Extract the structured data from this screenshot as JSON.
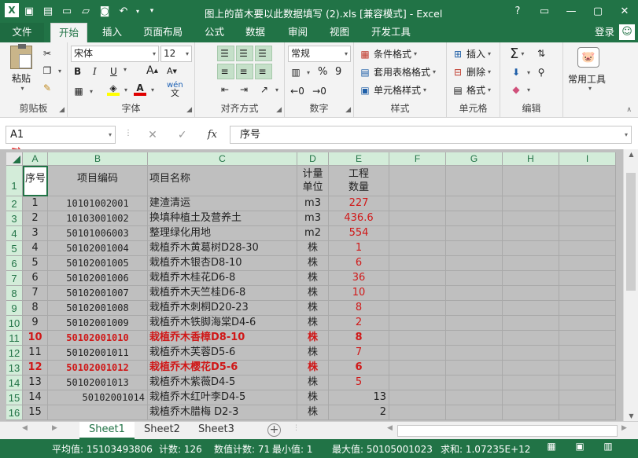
{
  "window": {
    "title": "图上的苗木要以此数据填写 (2).xls  [兼容模式] - Excel",
    "controls": [
      "?",
      "▭",
      "—",
      "▢",
      "✕"
    ]
  },
  "ribbon_tabs": {
    "file": "文件",
    "home": "开始",
    "insert": "插入",
    "layout": "页面布局",
    "formulas": "公式",
    "data": "数据",
    "review": "审阅",
    "view": "视图",
    "developer": "开发工具",
    "login": "登录"
  },
  "ribbon": {
    "clipboard": {
      "paste": "粘贴",
      "label": "剪贴板"
    },
    "font": {
      "name": "宋体",
      "size": "12",
      "bold": "B",
      "italic": "I",
      "underline": "U",
      "grow": "A",
      "shrink": "A",
      "wen": "wén",
      "label": "字体"
    },
    "alignment": {
      "label": "对齐方式"
    },
    "number": {
      "format": "常规",
      "percent": "%",
      "comma": "9",
      "label": "数字"
    },
    "styles": {
      "conditional": "条件格式",
      "table": "套用表格格式",
      "cell": "单元格样式",
      "label": "样式"
    },
    "cells": {
      "insert": "插入",
      "delete": "删除",
      "format": "格式",
      "label": "单元格"
    },
    "editing": {
      "label": "编辑"
    },
    "tools": {
      "label": "常用工具"
    }
  },
  "formula_bar": {
    "name_box": "A1",
    "cancel": "✕",
    "enter": "✓",
    "fx": "fx",
    "content": "序号"
  },
  "grid": {
    "columns": [
      "A",
      "B",
      "C",
      "D",
      "E",
      "F",
      "G",
      "H",
      "I"
    ],
    "rows": [
      {
        "n": "1",
        "a": "序号",
        "b": "项目编码",
        "c": "项目名称",
        "d1": "计量",
        "d2": "单位",
        "e1": "工程",
        "e2": "数量"
      },
      {
        "n": "2",
        "a": "1",
        "b": "10101002001",
        "c": "建渣清运",
        "d": "m3",
        "e": "227"
      },
      {
        "n": "3",
        "a": "2",
        "b": "10103001002",
        "c": "换填种植土及营养土",
        "d": "m3",
        "e": "436.6"
      },
      {
        "n": "4",
        "a": "3",
        "b": "50101006003",
        "c": "整理绿化用地",
        "d": "m2",
        "e": "554"
      },
      {
        "n": "5",
        "a": "4",
        "b": "50102001004",
        "c": "栽植乔木黄葛树D28-30",
        "d": "株",
        "e": "1"
      },
      {
        "n": "6",
        "a": "5",
        "b": "50102001005",
        "c": "栽植乔木银杏D8-10",
        "d": "株",
        "e": "6"
      },
      {
        "n": "7",
        "a": "6",
        "b": "50102001006",
        "c": "栽植乔木桂花D6-8",
        "d": "株",
        "e": "36"
      },
      {
        "n": "8",
        "a": "7",
        "b": "50102001007",
        "c": "栽植乔木天竺桂D6-8",
        "d": "株",
        "e": "10"
      },
      {
        "n": "9",
        "a": "8",
        "b": "50102001008",
        "c": "栽植乔木刺桐D20-23",
        "d": "株",
        "e": "8"
      },
      {
        "n": "10",
        "a": "9",
        "b": "50102001009",
        "c": "栽植乔木铁脚海棠D4-6",
        "d": "株",
        "e": "2"
      },
      {
        "n": "11",
        "a": "10",
        "b": "50102001010",
        "c": "栽植乔木香樟D8-10",
        "d": "株",
        "e": "8"
      },
      {
        "n": "12",
        "a": "11",
        "b": "50102001011",
        "c": "栽植乔木芙蓉D5-6",
        "d": "株",
        "e": "7"
      },
      {
        "n": "13",
        "a": "12",
        "b": "50102001012",
        "c": "栽植乔木樱花D5-6",
        "d": "株",
        "e": "6"
      },
      {
        "n": "14",
        "a": "13",
        "b": "50102001013",
        "c": "栽植乔木紫薇D4-5",
        "d": "株",
        "e": "5"
      },
      {
        "n": "15",
        "a": "14",
        "b": "50102001014",
        "c": "栽植乔木红叶李D4-5",
        "d": "株",
        "e": "13"
      },
      {
        "n": "16",
        "a": "15",
        "b": "",
        "c": "栽植乔木腊梅  D2-3",
        "d": "株",
        "e": "2"
      }
    ]
  },
  "sheets": [
    "Sheet1",
    "Sheet2",
    "Sheet3"
  ],
  "status": {
    "average": "平均值: 15103493806",
    "count": "计数: 126",
    "numcount": "数值计数: 71",
    "min": "最小值: 1",
    "max": "最大值: 50105001023",
    "sum": "求和: 1.07235E+12"
  }
}
